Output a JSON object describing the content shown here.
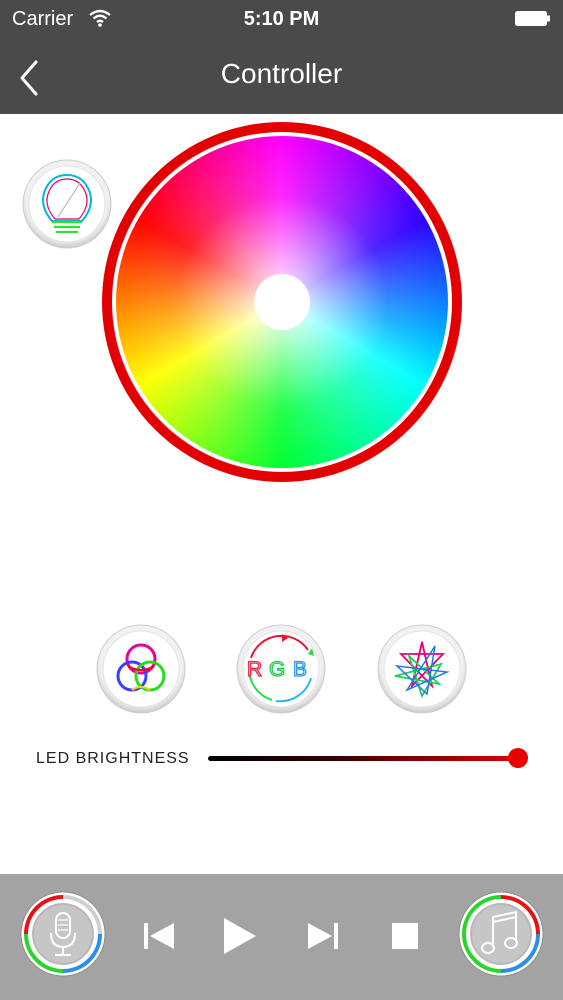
{
  "status_bar": {
    "carrier": "Carrier",
    "time": "5:10 PM"
  },
  "nav": {
    "title": "Controller",
    "back_icon": "chevron-left-icon"
  },
  "main": {
    "bulb_icon": "light-bulb-icon",
    "color_wheel": {
      "ring_color": "#e30000"
    },
    "modes": [
      {
        "name": "color-circles-mode-button",
        "icon": "tricolor-circles-icon"
      },
      {
        "name": "rgb-mode-button",
        "icon": "rgb-cycle-icon"
      },
      {
        "name": "star-mode-button",
        "icon": "star-polygon-icon"
      }
    ],
    "brightness": {
      "label": "LED  BRIGHTNESS",
      "value_percent": 100,
      "thumb_color": "#e80000"
    }
  },
  "bottom_bar": {
    "mic_icon": "microphone-icon",
    "prev_icon": "skip-previous-icon",
    "play_icon": "play-icon",
    "next_icon": "skip-next-icon",
    "stop_icon": "stop-icon",
    "music_icon": "music-note-icon"
  }
}
